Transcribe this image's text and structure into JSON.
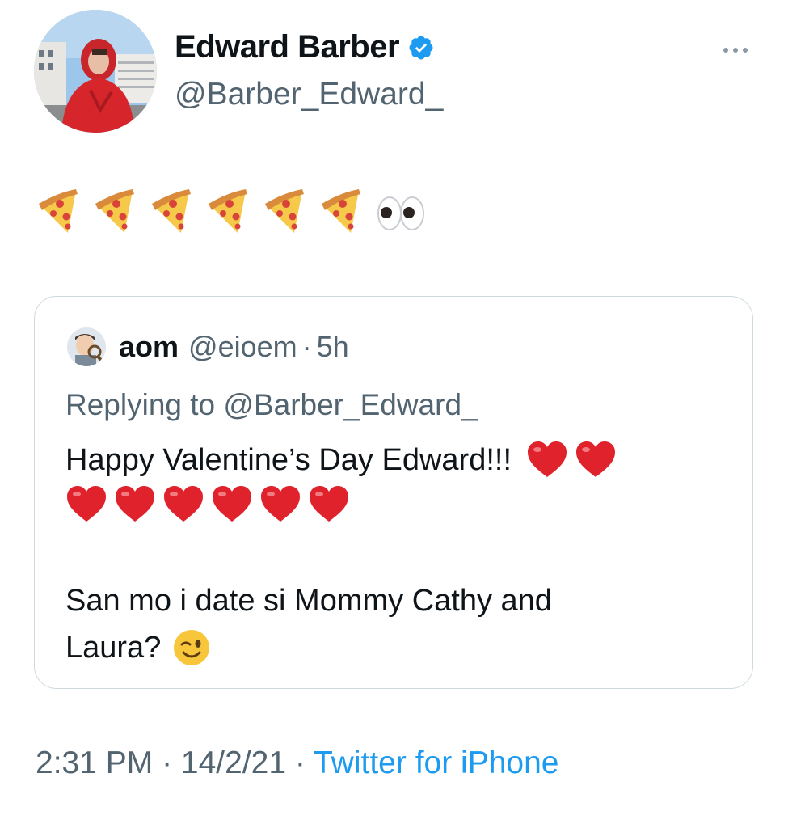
{
  "author": {
    "display_name": "Edward Barber",
    "handle": "@Barber_Edward_",
    "verified": true
  },
  "tweet": {
    "emojis": [
      "pizza",
      "pizza",
      "pizza",
      "pizza",
      "pizza",
      "pizza",
      "eyes"
    ]
  },
  "quoted": {
    "name": "aom",
    "handle": "@eioem",
    "separator": "·",
    "time": "5h",
    "reply_prefix": "Replying to ",
    "reply_mention": "@Barber_Edward_",
    "line1": "Happy Valentine’s Day Edward!!!",
    "line3": "San mo i date si Mommy Cathy and",
    "line4": "Laura?"
  },
  "meta": {
    "time": "2:31 PM",
    "sep1": " · ",
    "date": "14/2/21",
    "sep2": " · ",
    "source": "Twitter for iPhone"
  },
  "colors": {
    "text": "#0f1419",
    "secondary": "#536471",
    "link": "#1d9bf0",
    "verified": "#1d9bf0",
    "border": "#cfd9de"
  }
}
